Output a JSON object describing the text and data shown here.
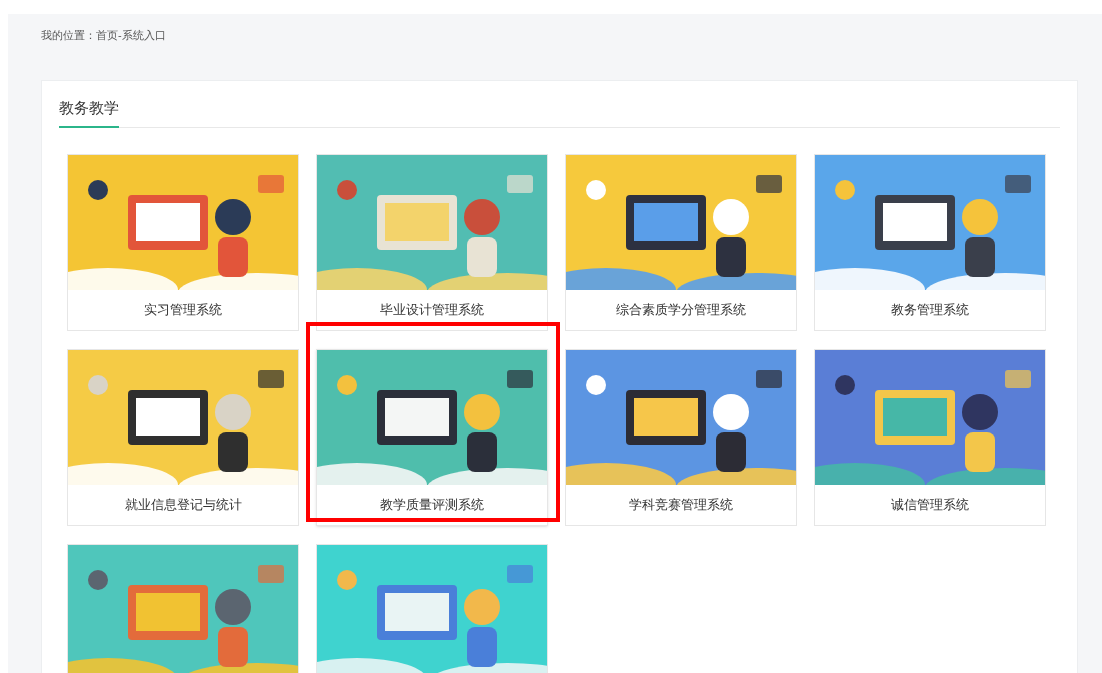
{
  "breadcrumb": "我的位置：首页-系统入口",
  "section": {
    "title": "教务教学"
  },
  "cards": [
    {
      "kind": "titled",
      "title": "实习管理系统",
      "highlighted": false
    },
    {
      "kind": "titled",
      "title": "毕业设计管理系统",
      "highlighted": false
    },
    {
      "kind": "titled",
      "title": "综合素质学分管理系统",
      "highlighted": false
    },
    {
      "kind": "titled",
      "title": "教务管理系统",
      "highlighted": false
    },
    {
      "kind": "titled",
      "title": "就业信息登记与统计",
      "highlighted": false
    },
    {
      "kind": "titled",
      "title": "教学质量评测系统",
      "highlighted": true
    },
    {
      "kind": "titled",
      "title": "学科竞赛管理系统",
      "highlighted": false
    },
    {
      "kind": "titled",
      "title": "诚信管理系统",
      "highlighted": false
    },
    {
      "kind": "picture"
    },
    {
      "kind": "picture"
    }
  ]
}
